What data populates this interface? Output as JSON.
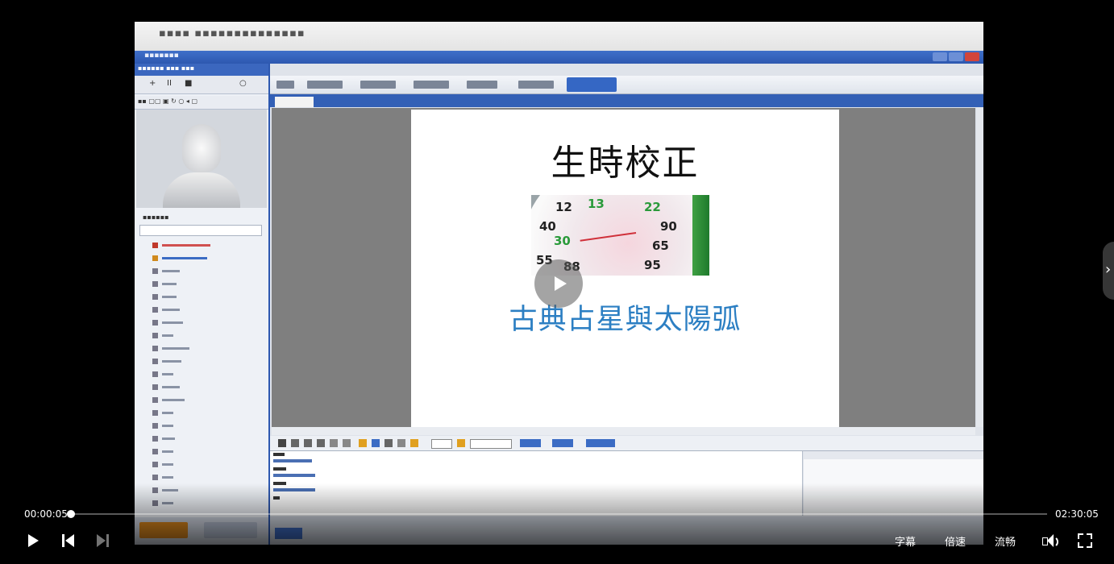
{
  "video": {
    "slide_title": "生時校正",
    "slide_subtitle": "古典占星與太陽弧",
    "clock_numbers": [
      "12",
      "13",
      "22",
      "40",
      "30",
      "90",
      "65",
      "55",
      "88",
      "95"
    ]
  },
  "player": {
    "current_time": "00:00:05",
    "total_time": "02:30:05",
    "progress": 0.0006,
    "subtitle_label": "字幕",
    "speed_label": "倍速",
    "quality_label": "流畅"
  },
  "icons": {
    "center_play": "play-icon",
    "next_panel": "chevron-right-icon",
    "play": "play-icon",
    "prev": "skip-previous-icon",
    "next": "skip-next-icon",
    "volume": "volume-icon",
    "fullscreen": "fullscreen-icon"
  },
  "next_panel_glyph": "›"
}
